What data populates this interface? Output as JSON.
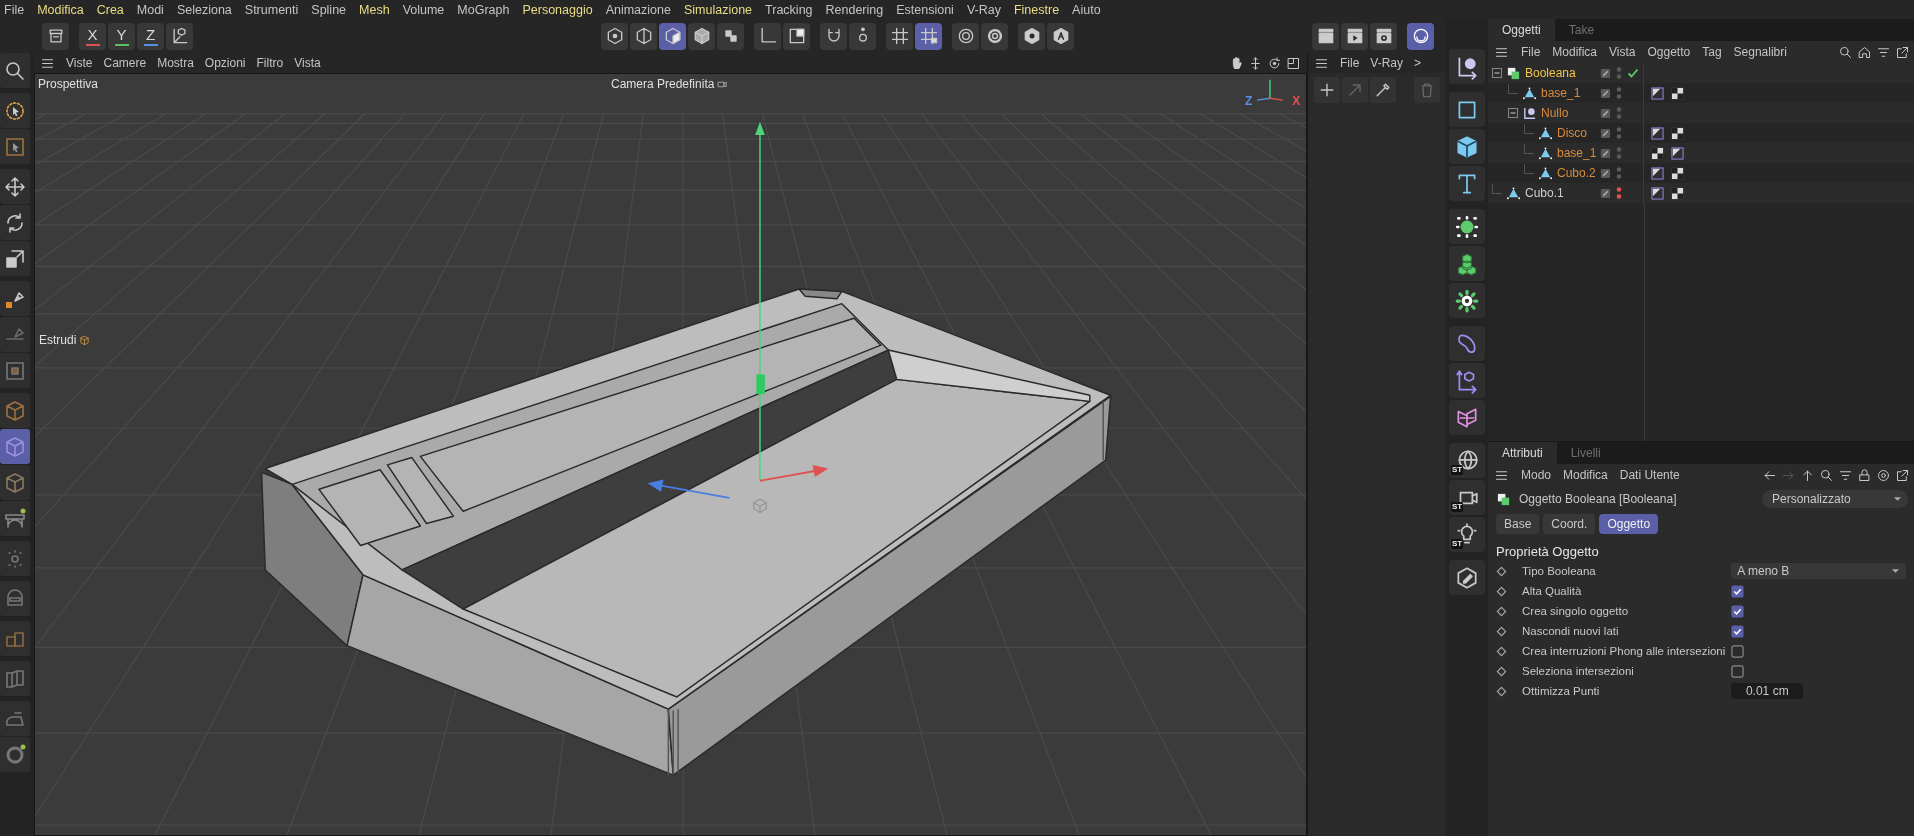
{
  "menu_bar": [
    {
      "label": "File",
      "highlighted": false
    },
    {
      "label": "Modifica",
      "highlighted": true
    },
    {
      "label": "Crea",
      "highlighted": true
    },
    {
      "label": "Modi",
      "highlighted": false
    },
    {
      "label": "Seleziona",
      "highlighted": false
    },
    {
      "label": "Strumenti",
      "highlighted": false
    },
    {
      "label": "Spline",
      "highlighted": false
    },
    {
      "label": "Mesh",
      "highlighted": true
    },
    {
      "label": "Volume",
      "highlighted": false
    },
    {
      "label": "MoGraph",
      "highlighted": false
    },
    {
      "label": "Personaggio",
      "highlighted": true
    },
    {
      "label": "Animazione",
      "highlighted": false
    },
    {
      "label": "Simulazione",
      "highlighted": true
    },
    {
      "label": "Tracking",
      "highlighted": false
    },
    {
      "label": "Rendering",
      "highlighted": false
    },
    {
      "label": "Estensioni",
      "highlighted": false
    },
    {
      "label": "V-Ray",
      "highlighted": false
    },
    {
      "label": "Finestre",
      "highlighted": true
    },
    {
      "label": "Aiuto",
      "highlighted": false
    }
  ],
  "toolbar": {
    "left": [
      {
        "kind": "archive",
        "selected": false
      }
    ],
    "axes": [
      {
        "label": "X",
        "color": "#e05252"
      },
      {
        "label": "Y",
        "color": "#5cc05c"
      },
      {
        "label": "Z",
        "color": "#5a8ee8"
      }
    ],
    "coord": [
      {
        "kind": "axis-box",
        "selected": false
      }
    ],
    "center": [
      [
        {
          "kind": "point-mode",
          "selected": false
        },
        {
          "kind": "edge-mode",
          "selected": false
        },
        {
          "kind": "polygon-mode",
          "selected": true
        },
        {
          "kind": "model-mode",
          "selected": false
        },
        {
          "kind": "uv-mode",
          "selected": false
        }
      ],
      [
        {
          "kind": "corner-axis",
          "selected": false
        },
        {
          "kind": "half-square",
          "selected": false
        }
      ],
      [
        {
          "kind": "magnet",
          "selected": false
        },
        {
          "kind": "gear-dots",
          "selected": false
        }
      ],
      [
        {
          "kind": "grid",
          "selected": false
        },
        {
          "kind": "grid-lock",
          "selected": true
        }
      ],
      [
        {
          "kind": "target",
          "selected": false
        },
        {
          "kind": "gear",
          "selected": false
        }
      ],
      [
        {
          "kind": "hex-eye",
          "selected": false
        },
        {
          "kind": "hex-letter",
          "selected": false
        }
      ]
    ],
    "right": [
      [
        {
          "kind": "clapper",
          "selected": false
        },
        {
          "kind": "clapper-play",
          "selected": false
        },
        {
          "kind": "clapper-gear",
          "selected": false
        }
      ],
      [
        {
          "kind": "orb",
          "selected": true
        }
      ]
    ]
  },
  "left_tools": [
    [
      {
        "kind": "search",
        "selected": false
      }
    ],
    [
      {
        "kind": "select-circle",
        "selected": false
      },
      {
        "kind": "select-box",
        "selected": false
      }
    ],
    [
      {
        "kind": "move",
        "selected": false
      },
      {
        "kind": "rotate",
        "selected": false
      },
      {
        "kind": "scale",
        "selected": false
      }
    ],
    [
      {
        "kind": "pen",
        "selected": false
      },
      {
        "kind": "knife",
        "selected": false
      },
      {
        "kind": "inset",
        "selected": false
      }
    ],
    [
      {
        "kind": "cube-open",
        "selected": false
      },
      {
        "kind": "cube-wire",
        "selected": true
      },
      {
        "kind": "cube-outline",
        "selected": false
      },
      {
        "kind": "bridge",
        "selected": false
      }
    ],
    [
      {
        "kind": "dots-figure",
        "selected": false
      }
    ],
    [
      {
        "kind": "helmet",
        "selected": false
      }
    ],
    [
      {
        "kind": "boxes",
        "selected": false
      }
    ],
    [
      {
        "kind": "books",
        "selected": false
      }
    ],
    [
      {
        "kind": "iron",
        "selected": false
      },
      {
        "kind": "ring",
        "selected": false
      }
    ]
  ],
  "viewport": {
    "menu": [
      "Viste",
      "Camere",
      "Mostra",
      "Opzioni",
      "Filtro",
      "Vista"
    ],
    "view_name": "Prospettiva",
    "camera": "Camera Predefinita",
    "tool_label": "Estrudi",
    "orientation_axes": [
      {
        "label": "Z",
        "color": "#5a8ee8"
      },
      {
        "label": "X",
        "color": "#e05252"
      }
    ]
  },
  "side_panel": {
    "menu": [
      "File",
      "V-Ray",
      ">"
    ]
  },
  "right_tools": [
    [
      {
        "kind": "null-object"
      }
    ],
    [
      {
        "kind": "square"
      },
      {
        "kind": "cube"
      },
      {
        "kind": "text-t"
      }
    ],
    [
      {
        "kind": "sphere-dots"
      },
      {
        "kind": "cubes"
      },
      {
        "kind": "cog"
      }
    ],
    [
      {
        "kind": "bean"
      },
      {
        "kind": "axis-cube"
      },
      {
        "kind": "twist"
      }
    ],
    [
      {
        "kind": "globe",
        "badge": "ST"
      },
      {
        "kind": "camera",
        "badge": "ST"
      },
      {
        "kind": "light",
        "badge": "ST"
      }
    ],
    [
      {
        "kind": "edit-hex"
      }
    ]
  ],
  "object_manager": {
    "tabs": [
      {
        "label": "Oggetti",
        "selected": true
      },
      {
        "label": "Take",
        "selected": false
      }
    ],
    "menu": [
      "File",
      "Modifica",
      "Vista",
      "Oggetto",
      "Tag",
      "Segnalibri"
    ],
    "objects": [
      {
        "name": "Booleana",
        "kind": "boolean",
        "selected": true,
        "expanded": true,
        "hidden": false,
        "children": [
          {
            "name": "base_1",
            "kind": "polygon",
            "selected": false,
            "hidden": false,
            "tags": [
              {
                "kind": "phong"
              },
              {
                "kind": "material"
              }
            ]
          },
          {
            "name": "Nullo",
            "kind": "null",
            "selected": false,
            "expanded": true,
            "hidden": false,
            "children": [
              {
                "name": "Disco",
                "kind": "polygon",
                "selected": false,
                "hidden": false,
                "tags": [
                  {
                    "kind": "phong"
                  },
                  {
                    "kind": "material"
                  }
                ]
              },
              {
                "name": "base_1",
                "kind": "polygon",
                "selected": false,
                "hidden": false,
                "tags": [
                  {
                    "kind": "material"
                  },
                  {
                    "kind": "phong"
                  }
                ]
              },
              {
                "name": "Cubo.2",
                "kind": "polygon",
                "selected": false,
                "hidden": false,
                "tags": [
                  {
                    "kind": "phong"
                  },
                  {
                    "kind": "material"
                  }
                ]
              }
            ]
          }
        ]
      },
      {
        "name": "Cubo.1",
        "kind": "polygon",
        "selected": false,
        "hidden": true,
        "tags": [
          {
            "kind": "phong"
          },
          {
            "kind": "material"
          }
        ]
      }
    ]
  },
  "attributes": {
    "tabs": [
      {
        "label": "Attributi",
        "selected": true
      },
      {
        "label": "Livelli",
        "selected": false
      }
    ],
    "menu": [
      "Modo",
      "Modifica",
      "Dati Utente"
    ],
    "object_title": "Oggetto Booleana [Booleana]",
    "preset": "Personalizzato",
    "sub_tabs": [
      {
        "label": "Base",
        "selected": false
      },
      {
        "label": "Coord.",
        "selected": false
      },
      {
        "label": "Oggetto",
        "selected": true
      }
    ],
    "section": "Proprietà Oggetto",
    "params": [
      {
        "kind": "dropdown",
        "label": "Tipo Booleana",
        "value": "A meno B"
      },
      {
        "kind": "checkbox",
        "label": "Alta Qualità",
        "checked": true
      },
      {
        "kind": "checkbox",
        "label": "Crea singolo oggetto",
        "checked": true
      },
      {
        "kind": "checkbox",
        "label": "Nascondi nuovi lati",
        "checked": true
      },
      {
        "kind": "checkbox",
        "label": "Crea interruzioni Phong alle intersezioni",
        "checked": false
      },
      {
        "kind": "checkbox",
        "label": "Seleziona intersezioni",
        "checked": false
      },
      {
        "kind": "number",
        "label": "Ottimizza Punti",
        "value": "0.01 cm"
      }
    ]
  }
}
